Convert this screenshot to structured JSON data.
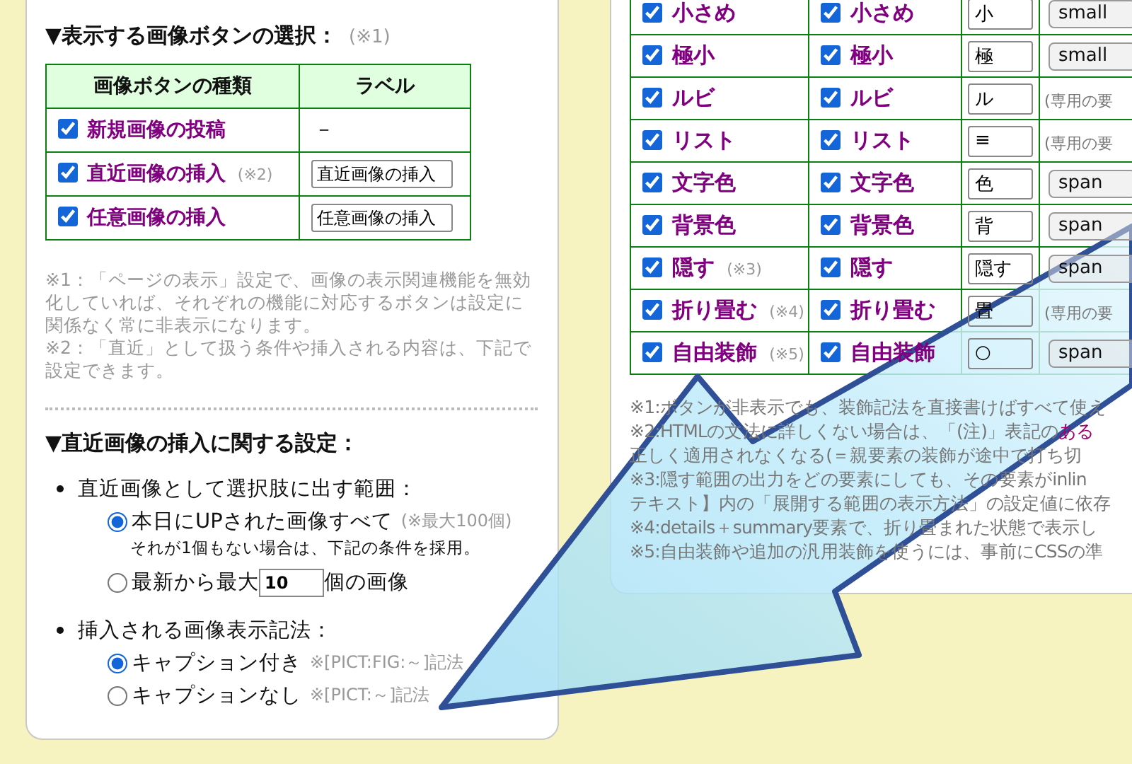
{
  "image_button_section": {
    "heading": "▼表示する画像ボタンの選択：",
    "note_ref": "(※1)",
    "columns": [
      "画像ボタンの種類",
      "ラベル"
    ],
    "rows": [
      {
        "label": "新規画像の投稿",
        "checked": true,
        "kind": "text",
        "value": "－"
      },
      {
        "label": "直近画像の挿入",
        "note_ref": "(※2)",
        "checked": true,
        "kind": "input",
        "value": "直近画像の挿入"
      },
      {
        "label": "任意画像の挿入",
        "checked": true,
        "kind": "input",
        "value": "任意画像の挿入"
      }
    ],
    "notes": [
      "※1：「ページの表示」設定で、画像の表示関連機能を無効化していれば、それぞれの機能に対応するボタンは設定に関係なく常に非表示になります。",
      "※2：「直近」として扱う条件や挿入される内容は、下記で設定できます。"
    ]
  },
  "recent_section": {
    "heading": "▼直近画像の挿入に関する設定：",
    "items": [
      {
        "label": "直近画像として選択肢に出す範囲：",
        "options": [
          {
            "kind": "plain",
            "label": "本日にUPされた画像すべて",
            "note": "(※最大100個)",
            "sub": "それが1個もない場合は、下記の条件を採用。",
            "selected": true
          },
          {
            "kind": "number",
            "label": "最新から最大",
            "value": "10",
            "label_after": "個の画像",
            "selected": false
          }
        ]
      },
      {
        "label": "挿入される画像表示記法：",
        "options": [
          {
            "kind": "plain",
            "label": "キャプション付き",
            "note": "※[PICT:FIG:～]記法",
            "selected": true
          },
          {
            "kind": "plain",
            "label": "キャプションなし",
            "note": "※[PICT:～]記法",
            "selected": false
          }
        ]
      }
    ]
  },
  "decoration_table": {
    "rows": [
      {
        "name": "小さめ",
        "checked": true,
        "name_2": "小さめ",
        "checked_2": true,
        "short": "小",
        "option": {
          "kind": "select",
          "text": "small"
        }
      },
      {
        "name": "極小",
        "checked": true,
        "name_2": "極小",
        "checked_2": true,
        "short": "極",
        "option": {
          "kind": "select",
          "text": "small"
        }
      },
      {
        "name": "ルビ",
        "checked": true,
        "name_2": "ルビ",
        "checked_2": true,
        "short": "ル",
        "option": {
          "kind": "text",
          "text": "(専用の要"
        }
      },
      {
        "name": "リスト",
        "checked": true,
        "name_2": "リスト",
        "checked_2": true,
        "short": "≡",
        "option": {
          "kind": "text",
          "text": "(専用の要"
        }
      },
      {
        "name": "文字色",
        "checked": true,
        "name_2": "文字色",
        "checked_2": true,
        "short": "色",
        "option": {
          "kind": "select",
          "text": "span"
        }
      },
      {
        "name": "背景色",
        "checked": true,
        "name_2": "背景色",
        "checked_2": true,
        "short": "背",
        "option": {
          "kind": "select",
          "text": "span"
        }
      },
      {
        "name": "隠す",
        "note_ref": "(※3)",
        "checked": true,
        "name_2": "隠す",
        "checked_2": true,
        "short": "隠す",
        "option": {
          "kind": "select",
          "text": "span"
        }
      },
      {
        "name": "折り畳む",
        "note_ref": "(※4)",
        "checked": true,
        "name_2": "折り畳む",
        "checked_2": true,
        "short": "畳",
        "option": {
          "kind": "text",
          "text": "(専用の要"
        }
      },
      {
        "name": "自由装飾",
        "note_ref": "(※5)",
        "checked": true,
        "name_2": "自由装飾",
        "checked_2": true,
        "short": "○",
        "option": {
          "kind": "select",
          "text": "span"
        }
      }
    ],
    "notes": [
      {
        "text": "※1:ボタンが非表示でも、装飾記法を直接書けばすべて使え"
      },
      {
        "text": "※2:HTMLの文法に詳しくない場合は、「(注)」表記の",
        "link": "ある"
      },
      {
        "text": "正しく適用されなくなる(＝親要素の装飾が途中で打ち切"
      },
      {
        "text": "※3:隠す範囲の出力をどの要素にしても、その要素がinlin"
      },
      {
        "text": "テキスト】内の「展開する範囲の表示方法」の設定値に依存"
      },
      {
        "text": "※4:details＋summary要素で、折り畳まれた状態で表示し"
      },
      {
        "text": "※5:自由装飾や追加の汎用装飾を使うには、事前にCSSの準"
      }
    ]
  }
}
